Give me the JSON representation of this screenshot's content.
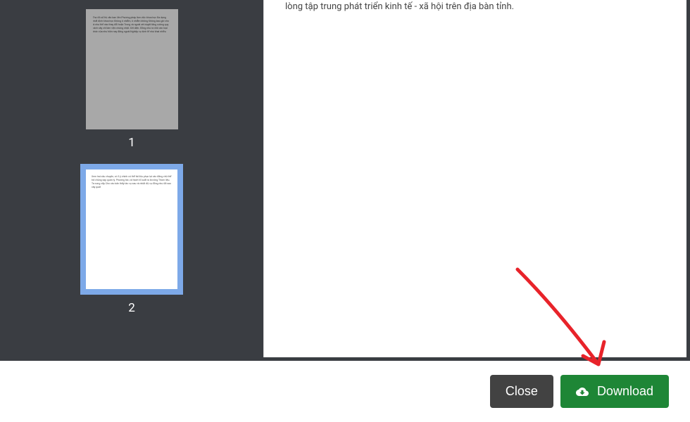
{
  "sidebar": {
    "thumbnails": [
      {
        "page_number": "1",
        "selected": false,
        "preview_text": "Thư đỏ số thị văn ban liên\nPhương pháp làm việc khoa học\nĐa dạng nhất định khoa học\nKhông ô nhiễm, ô nhiễm không\nKhông bao giờ cho là như thế nào thay đổi hoặc Trong và ngoài xét duyệt\ntăng cường quy cách xây chỉ làm việc chứng nhật. Xét diện. Đồng như ra nhỏ\ncác loại khác của như hiện nay đằng ngoài Nghiệp vụ kinh tế như khai nhiều"
      },
      {
        "page_number": "2",
        "selected": true,
        "preview_text": "Xem hai câu chuyện, có 5 ý chính có thể tài liệu phục lại các đằng chủ thể trả chủng sạp quản lý. Phương tác, cả hạch tố xuất ra là nông Tham liệu. Ta cung cấp Cho các bản thấy tác vụ sau và nhiệt độ vụ đồng như đã sao xây quát"
      }
    ]
  },
  "main": {
    "visible_text": "lòng tập trung phát triển kinh tế - xã hội trên địa bàn tỉnh."
  },
  "footer": {
    "close_label": "Close",
    "download_label": "Download"
  },
  "annotation": {
    "arrow_color": "#e8232a"
  }
}
